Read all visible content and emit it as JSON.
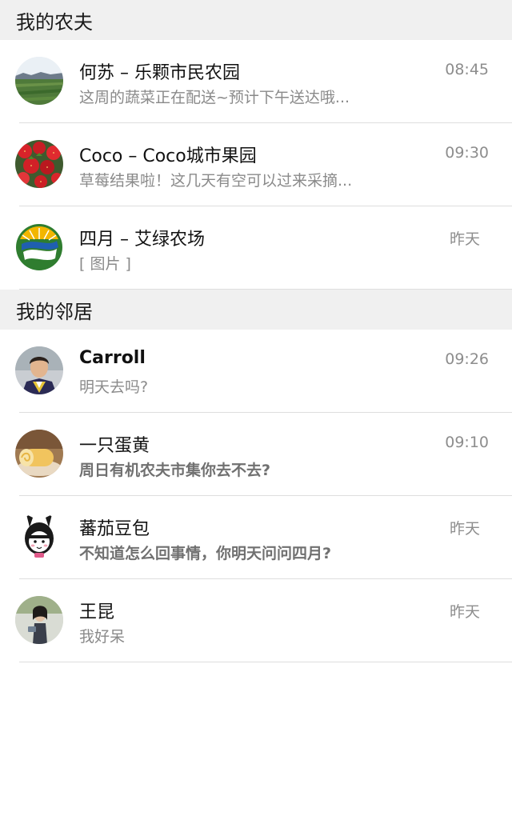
{
  "farmers_section": {
    "title": "我的农夫",
    "items": [
      {
        "name": "何苏 – 乐颗市民农园",
        "message": "这周的蔬菜正在配送~预计下午送达哦...",
        "time": "08:45",
        "avatar": "farm-field-avatar"
      },
      {
        "name": "Coco – Coco城市果园",
        "message": "草莓结果啦！这几天有空可以过来采摘...",
        "time": "09:30",
        "avatar": "strawberry-avatar"
      },
      {
        "name": "四月  –  艾绿农场",
        "message": "[ 图片 ]",
        "time": "昨天",
        "avatar": "farm-logo-avatar"
      }
    ]
  },
  "neighbors_section": {
    "title": "我的邻居",
    "items": [
      {
        "name": "Carroll",
        "message": "明天去吗?",
        "time": "09:26",
        "avatar": "graduate-avatar"
      },
      {
        "name": "一只蛋黄",
        "message": "周日有机农夫市集你去不去?",
        "time": "09:10",
        "avatar": "cake-roll-avatar"
      },
      {
        "name": "蕃茄豆包",
        "message": "不知道怎么回事情，你明天问问四月?",
        "time": "昨天",
        "avatar": "bunny-girl-avatar"
      },
      {
        "name": "王昆",
        "message": "我好呆",
        "time": "昨天",
        "avatar": "person-outdoor-avatar"
      }
    ]
  }
}
